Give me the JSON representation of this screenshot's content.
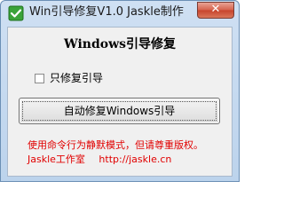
{
  "window": {
    "title": "Win引导修复V1.0  Jaskle制作",
    "close_label": "✕",
    "app_icon": "green-check-icon"
  },
  "main": {
    "heading": "Windows引导修复",
    "checkbox": {
      "label": "只修复引导",
      "checked": false
    },
    "repair_button_label": "自动修复Windows引导",
    "notice": "使用命令行为静默模式，但请尊重版权。",
    "footer_studio": "Jaskle工作室",
    "footer_url": "http://jaskle.cn"
  },
  "colors": {
    "notice_text": "#e10000",
    "icon_green": "#3aa33a",
    "close_red": "#c7432b"
  }
}
